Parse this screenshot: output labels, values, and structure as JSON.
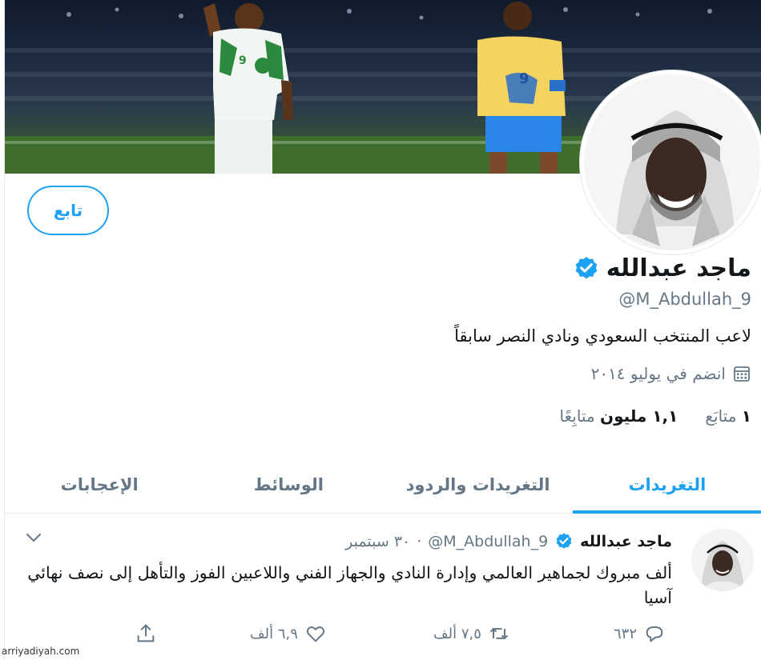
{
  "profile": {
    "follow_label": "تابع",
    "name": "ماجد عبدالله",
    "handle": "@M_Abdullah_9",
    "bio": "لاعب المنتخب السعودي ونادي النصر سابقاً",
    "joined": "انضم في يوليو ٢٠١٤",
    "following_count": "١",
    "following_label": "متابَع",
    "followers_count": "١,١ مليون",
    "followers_label": "متابِعًا"
  },
  "tabs": [
    {
      "label": "التغريدات",
      "active": true
    },
    {
      "label": "التغريدات والردود",
      "active": false
    },
    {
      "label": "الوسائط",
      "active": false
    },
    {
      "label": "الإعجابات",
      "active": false
    }
  ],
  "tweet": {
    "name": "ماجد عبدالله",
    "handle": "@M_Abdullah_9",
    "dot": "·",
    "date": "٣٠ سبتمبر",
    "text": "ألف مبروك لجماهير العالمي وإدارة النادي والجهاز الفني واللاعبين الفوز والتأهل إلى نصف نهائي آسيا",
    "replies": "٦٣٢",
    "retweets": "٧,٥ ألف",
    "likes": "٦,٩ ألف"
  },
  "watermark": "arriyadiyah.com",
  "colors": {
    "accent": "#1da1f2",
    "muted": "#657786",
    "text": "#14171a"
  },
  "icons": [
    "verified-icon",
    "calendar-icon",
    "chevron-down-icon",
    "reply-icon",
    "retweet-icon",
    "like-icon",
    "share-icon"
  ]
}
